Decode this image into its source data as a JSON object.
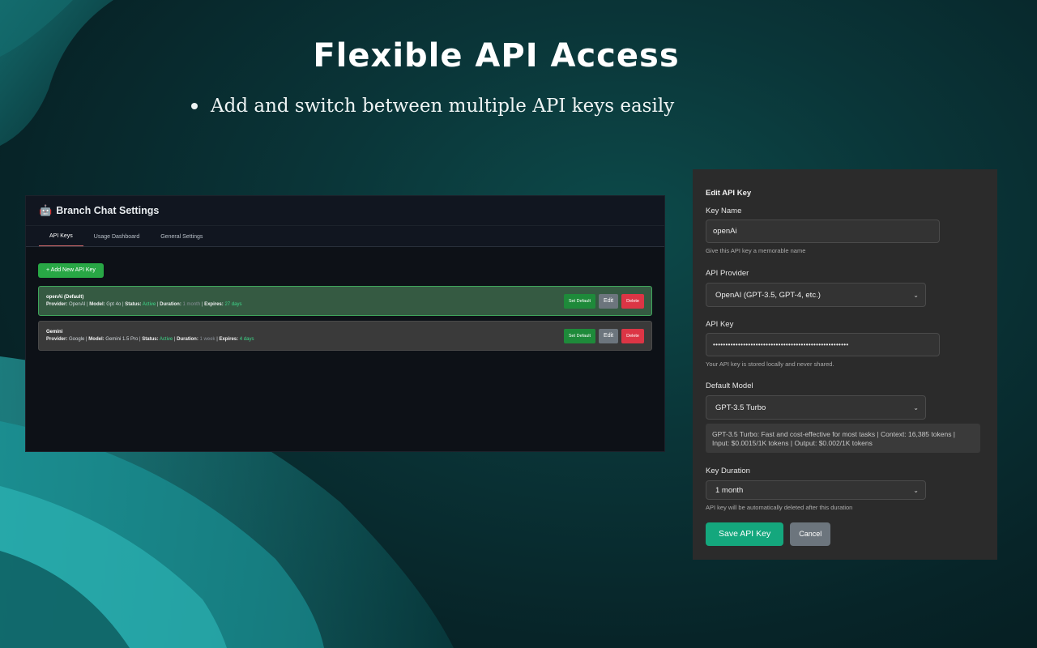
{
  "hero": {
    "title": "Flexible API Access",
    "bullet": "Add and switch between multiple API keys easily"
  },
  "settings": {
    "robot_icon": "🤖",
    "title": "Branch Chat Settings",
    "tabs": [
      {
        "label": "API Keys",
        "active": true
      },
      {
        "label": "Usage Dashboard",
        "active": false
      },
      {
        "label": "General Settings",
        "active": false
      }
    ],
    "add_button": "+ Add New API Key",
    "keys": [
      {
        "name": "openAi (Default)",
        "provider_label": "Provider:",
        "provider": "OpenAI",
        "model_label": "Model:",
        "model": "Gpt 4o",
        "status_label": "Status:",
        "status": "Active",
        "duration_label": "Duration:",
        "duration": "1 month",
        "expires_label": "Expires:",
        "expires": "27 days",
        "set_default": "Set Default",
        "edit": "Edit",
        "delete": "Delete"
      },
      {
        "name": "Gemini",
        "provider_label": "Provider:",
        "provider": "Google",
        "model_label": "Model:",
        "model": "Gemini 1.5 Pro",
        "status_label": "Status:",
        "status": "Active",
        "duration_label": "Duration:",
        "duration": "1 week",
        "expires_label": "Expires:",
        "expires": "4 days",
        "set_default": "Set Default",
        "edit": "Edit",
        "delete": "Delete"
      }
    ]
  },
  "edit": {
    "title": "Edit API Key",
    "key_name_label": "Key Name",
    "key_name_value": "openAi",
    "key_name_help": "Give this API key a memorable name",
    "provider_label": "API Provider",
    "provider_value": "OpenAI (GPT-3.5, GPT-4, etc.)",
    "api_key_label": "API Key",
    "api_key_value": "••••••••••••••••••••••••••••••••••••••••••••••••••••••",
    "api_key_help": "Your API key is stored locally and never shared.",
    "model_label": "Default Model",
    "model_value": "GPT-3.5 Turbo",
    "model_info": "GPT-3.5 Turbo: Fast and cost-effective for most tasks | Context: 16,385 tokens | Input: $0.0015/1K tokens | Output: $0.002/1K tokens",
    "duration_label": "Key Duration",
    "duration_value": "1 month",
    "duration_help": "API key will be automatically deleted after this duration",
    "save": "Save API Key",
    "cancel": "Cancel"
  },
  "colors": {
    "accent_green": "#28a745",
    "save_teal": "#14a77d",
    "delete_red": "#dc3545",
    "status_green": "#3ed98a"
  }
}
